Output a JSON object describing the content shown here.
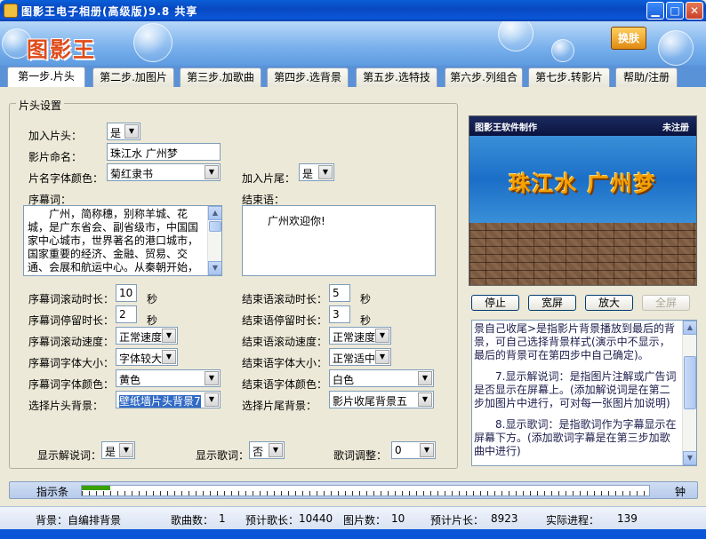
{
  "window": {
    "title": "图影王电子相册(高级版)9.8 共享",
    "minimize_icon": "minimize-icon",
    "maximize_icon": "maximize-icon",
    "close_icon": "close-icon",
    "accent": "#0a56d8"
  },
  "banner": {
    "logo": "图影王",
    "skin_button": "换肤"
  },
  "tabs": [
    {
      "label": "第一步.片头",
      "active": true
    },
    {
      "label": "第二步.加图片"
    },
    {
      "label": "第三步.加歌曲"
    },
    {
      "label": "第四步.选背景"
    },
    {
      "label": "第五步.选特技"
    },
    {
      "label": "第六步.列组合"
    },
    {
      "label": "第七步.转影片"
    },
    {
      "label": "帮助/注册"
    }
  ],
  "header": {
    "group_title": "片头设置"
  },
  "form": {
    "add_header_label": "加入片头：",
    "add_header_value": "是",
    "film_name_label": "影片命名：",
    "film_name_value": "珠江水 广州梦",
    "font_color_label": "片名字体颜色：",
    "font_color_value": "菊红隶书",
    "add_footer_label": "加入片尾：",
    "add_footer_value": "是",
    "preface_label": "序幕词：",
    "preface_text": "　　广州，简称穗，别称羊城、花城，是广东省会、副省级市，中国国家中心城市，世界著名的港口城市，国家重要的经济、金融、贸易、交通、会展和航运中心。从秦朝开始，广州",
    "ending_label": "结束语：",
    "ending_text": "　　广州欢迎你!",
    "preface_scroll_label": "序幕词滚动时长：",
    "preface_scroll_value": "10",
    "preface_stay_label": "序幕词停留时长：",
    "preface_stay_value": "2",
    "seconds_unit": "秒",
    "ending_scroll_label": "结束语滚动时长：",
    "ending_scroll_value": "5",
    "ending_stay_label": "结束语停留时长：",
    "ending_stay_value": "3",
    "preface_speed_label": "序幕词滚动速度：",
    "preface_speed_value": "正常速度",
    "ending_speed_label": "结束语滚动速度：",
    "ending_speed_value": "正常速度",
    "preface_size_label": "序幕词字体大小：",
    "preface_size_value": "字体较大",
    "ending_size_label": "结束语字体大小：",
    "ending_size_value": "正常适中",
    "preface_color_label": "序幕词字体颜色：",
    "preface_color_value": "黄色",
    "ending_color_label": "结束语字体颜色：",
    "ending_color_value": "白色",
    "header_bg_label": "选择片头背景：",
    "header_bg_value": "壁纸墙片头背景7",
    "footer_bg_label": "选择片尾背景：",
    "footer_bg_value": "影片收尾背景五",
    "show_narration_label": "显示解说词：",
    "show_narration_value": "是",
    "show_lyrics_label": "显示歌词：",
    "show_lyrics_value": "否",
    "lyrics_adjust_label": "歌词调整：",
    "lyrics_adjust_value": "0"
  },
  "preview": {
    "brand": "图影王软件制作",
    "status": "未注册",
    "title": "珠江水  广州梦"
  },
  "controls": {
    "stop": "停止",
    "widescreen": "宽屏",
    "zoom_in": "放大",
    "fullscreen": "全屏"
  },
  "help": {
    "paragraphs": [
      "景自己收尾>是指影片背景播放到最后的背景，可自己选择背景样式(演示中不显示，最后的背景可在第四步中自己确定)。",
      "　　7.显示解说词：是指图片注解或广告词是否显示在屏幕上。(添加解说词是在第二步加图片中进行，可对每一张图片加说明)",
      "　　8.显示歌词：是指歌词作为字幕显示在屏幕下方。(添加歌词字幕是在第三步加歌曲中进行)"
    ]
  },
  "indicator": {
    "label": "指示条",
    "right_label": "钟",
    "progress": 0.05
  },
  "status": {
    "background_label": "背景：自编排背景",
    "songs_label": "歌曲数：",
    "songs_value": "1",
    "est_song_len_label": "预计歌长：",
    "est_song_len_value": "10440",
    "pictures_label": "图片数：",
    "pictures_value": "10",
    "est_film_len_label": "预计片长：",
    "est_film_len_value": "8923",
    "progress_label": "实际进程：",
    "progress_value": "139"
  }
}
